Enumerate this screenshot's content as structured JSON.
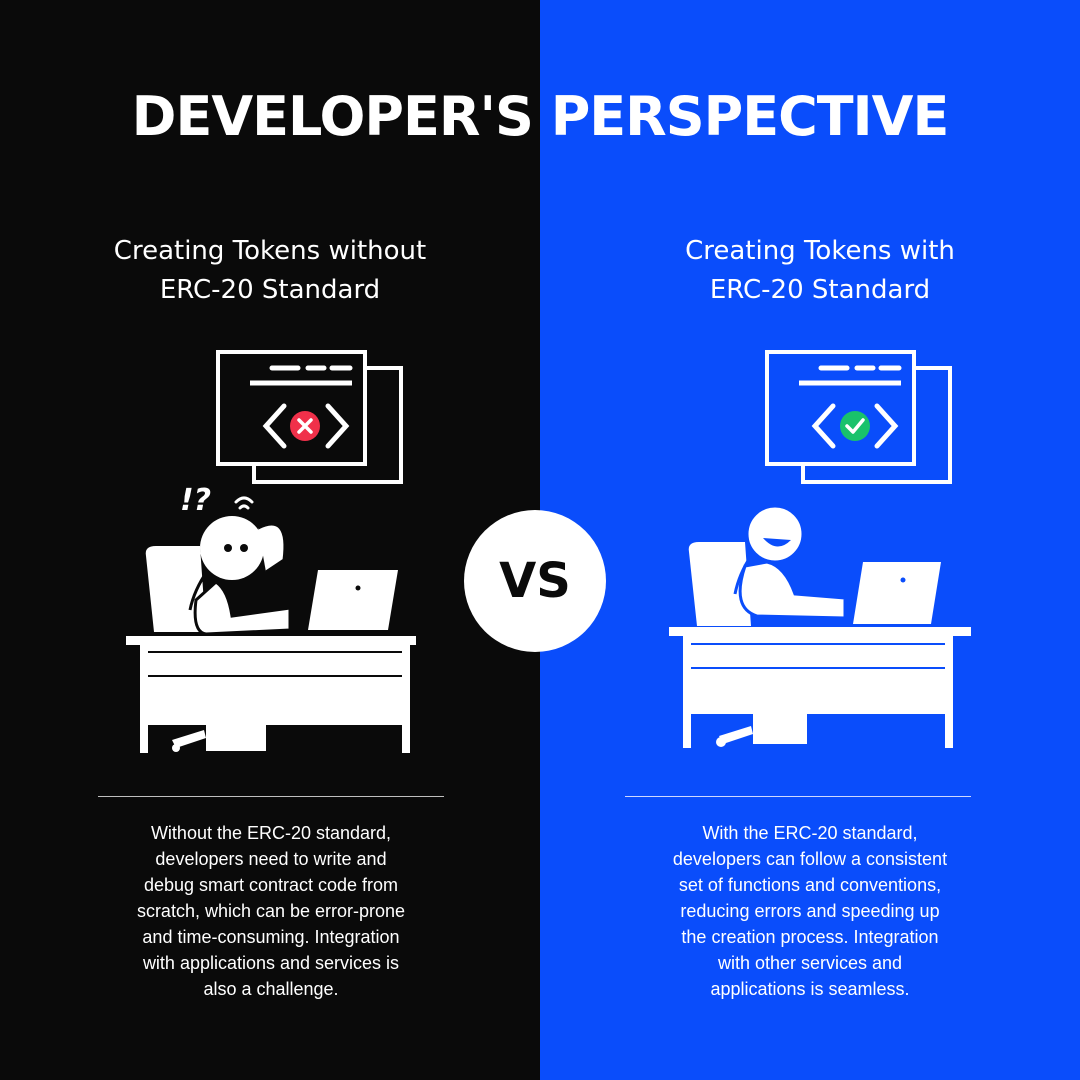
{
  "title": "DEVELOPER'S PERSPECTIVE",
  "left": {
    "heading_lines": [
      "Creating Tokens without",
      "ERC-20 Standard"
    ],
    "status_icon": "error-x-icon",
    "exclamation": "!?",
    "description_lines": [
      "Without the ERC-20 standard,",
      "developers need to write and",
      "debug smart contract code from",
      "scratch, which can be error-prone",
      "and time-consuming. Integration",
      "with applications and services is",
      "also a challenge."
    ]
  },
  "vs": "VS",
  "right": {
    "heading_lines": [
      "Creating Tokens with",
      "ERC-20 Standard"
    ],
    "status_icon": "success-check-icon",
    "description_lines": [
      "With the ERC-20 standard,",
      "developers can follow a consistent",
      "set of functions and conventions,",
      "reducing errors and speeding up",
      "the creation process. Integration",
      "with other services and",
      "applications is seamless."
    ]
  },
  "colors": {
    "left_bg": "#0a0a0a",
    "right_bg": "#0a4dfb",
    "error_red": "#f0304a",
    "success_green": "#19c26b",
    "text": "#ffffff"
  }
}
